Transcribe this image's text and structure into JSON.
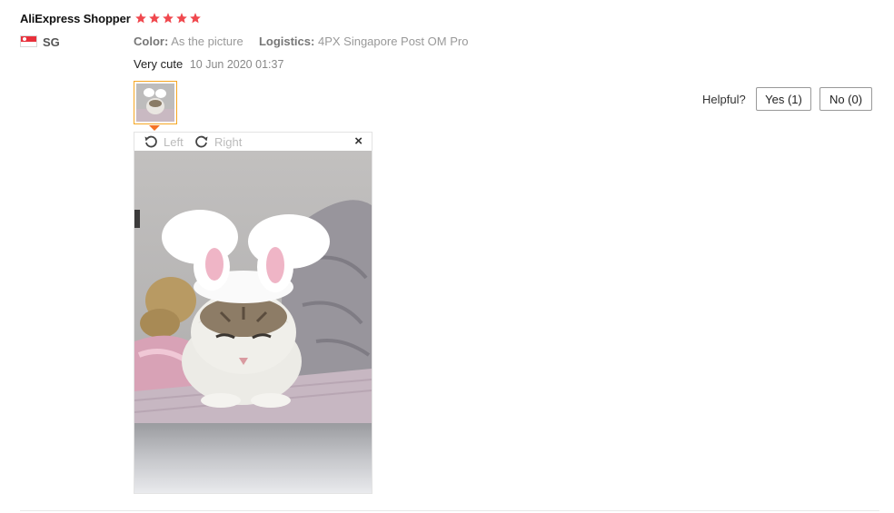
{
  "review": {
    "reviewer_name": "AliExpress Shopper",
    "rating": 5,
    "country_code": "SG",
    "color_label": "Color:",
    "color_value": "As the picture",
    "logistics_label": "Logistics:",
    "logistics_value": "4PX Singapore Post OM Pro",
    "content": "Very cute",
    "date": "10 Jun 2020 01:37"
  },
  "viewer": {
    "rotate_left_label": "Left",
    "rotate_right_label": "Right",
    "close_glyph": "×"
  },
  "feedback": {
    "helpful_label": "Helpful?",
    "yes_label": "Yes (1)",
    "no_label": "No (0)"
  },
  "colors": {
    "star": "#f0484e",
    "thumb_border": "#f5a623",
    "caret": "#f57224"
  },
  "icons": [
    "star-icon",
    "sg-flag-icon",
    "rotate-left-icon",
    "rotate-right-icon",
    "close-icon"
  ]
}
